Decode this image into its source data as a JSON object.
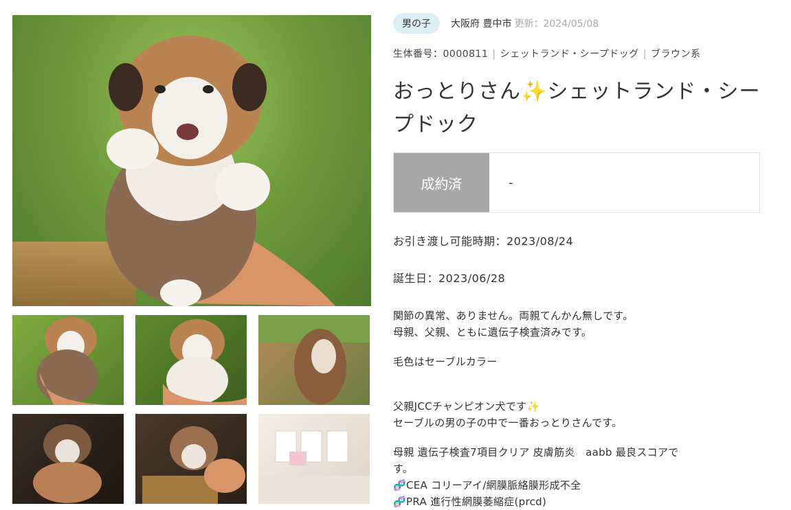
{
  "listing": {
    "sex": "男の子",
    "location": "大阪府 豊中市",
    "updated": "更新：2024/05/08",
    "id_label": "生体番号：0000811",
    "breed": "シェットランド・シープドッグ",
    "color_type": "ブラウン系",
    "title_part1": "おっとりさん",
    "title_sparkle": "✨",
    "title_part2": "シェットランド・シープドック",
    "status": "成約済",
    "price": "-",
    "handover": "お引き渡し可能時期：2023/08/24",
    "birthday": "誕生日：2023/06/28"
  },
  "description": {
    "line1": "関節の異常、ありません。両親てんかん無しです。",
    "line2": "母親、父親、ともに遺伝子検査済みです。",
    "line3": "毛色はセーブルカラー",
    "line4": "父親JCCチャンピオン犬です",
    "line4_icon": "✨",
    "line5": "セーブルの男の子の中で一番おっとりさんです。",
    "line6": "母親 遺伝子検査7項目クリア 皮膚筋炎　aabb 最良スコアで",
    "line7": "す。",
    "dna_icon": "🧬",
    "line8": "CEA コリーアイ/網膜脈絡膜形成不全",
    "line9": "PRA 進行性網膜萎縮症(prcd)"
  },
  "gallery": {
    "thumbnail_count": 6
  }
}
